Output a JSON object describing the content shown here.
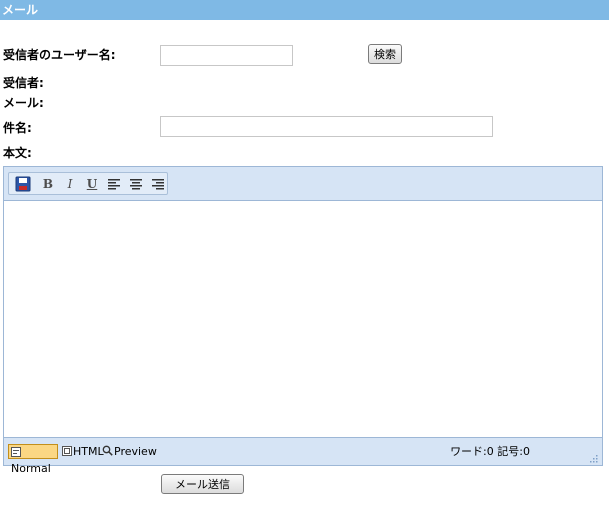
{
  "window": {
    "title": "メール"
  },
  "form": {
    "recipient_username_label": "受信者のユーザー名:",
    "recipient_username_value": "",
    "search_button_label": "検索",
    "recipient_label": "受信者:",
    "email_label": "メール:",
    "subject_label": "件名:",
    "subject_value": "",
    "body_label": "本文:",
    "send_button_label": "メール送信"
  },
  "editor": {
    "toolbar": {
      "buttons": [
        {
          "name": "save-icon",
          "label": ""
        },
        {
          "name": "bold-icon",
          "label": "B"
        },
        {
          "name": "italic-icon",
          "label": "I"
        },
        {
          "name": "underline-icon",
          "label": "U"
        },
        {
          "name": "align-left-icon",
          "label": ""
        },
        {
          "name": "align-center-icon",
          "label": ""
        },
        {
          "name": "align-right-icon",
          "label": ""
        }
      ]
    },
    "content": "",
    "modes": {
      "normal": "Normal",
      "html": "HTML",
      "preview": "Preview"
    },
    "active_mode": "Normal",
    "word_count_label": "ワード:0",
    "char_count_label": "記号:0"
  },
  "colors": {
    "titlebar_bg": "#7fb9e5",
    "editor_chrome_bg": "#d6e4f5",
    "editor_border": "#9db7d6",
    "active_mode_bg": "#fbd784"
  }
}
